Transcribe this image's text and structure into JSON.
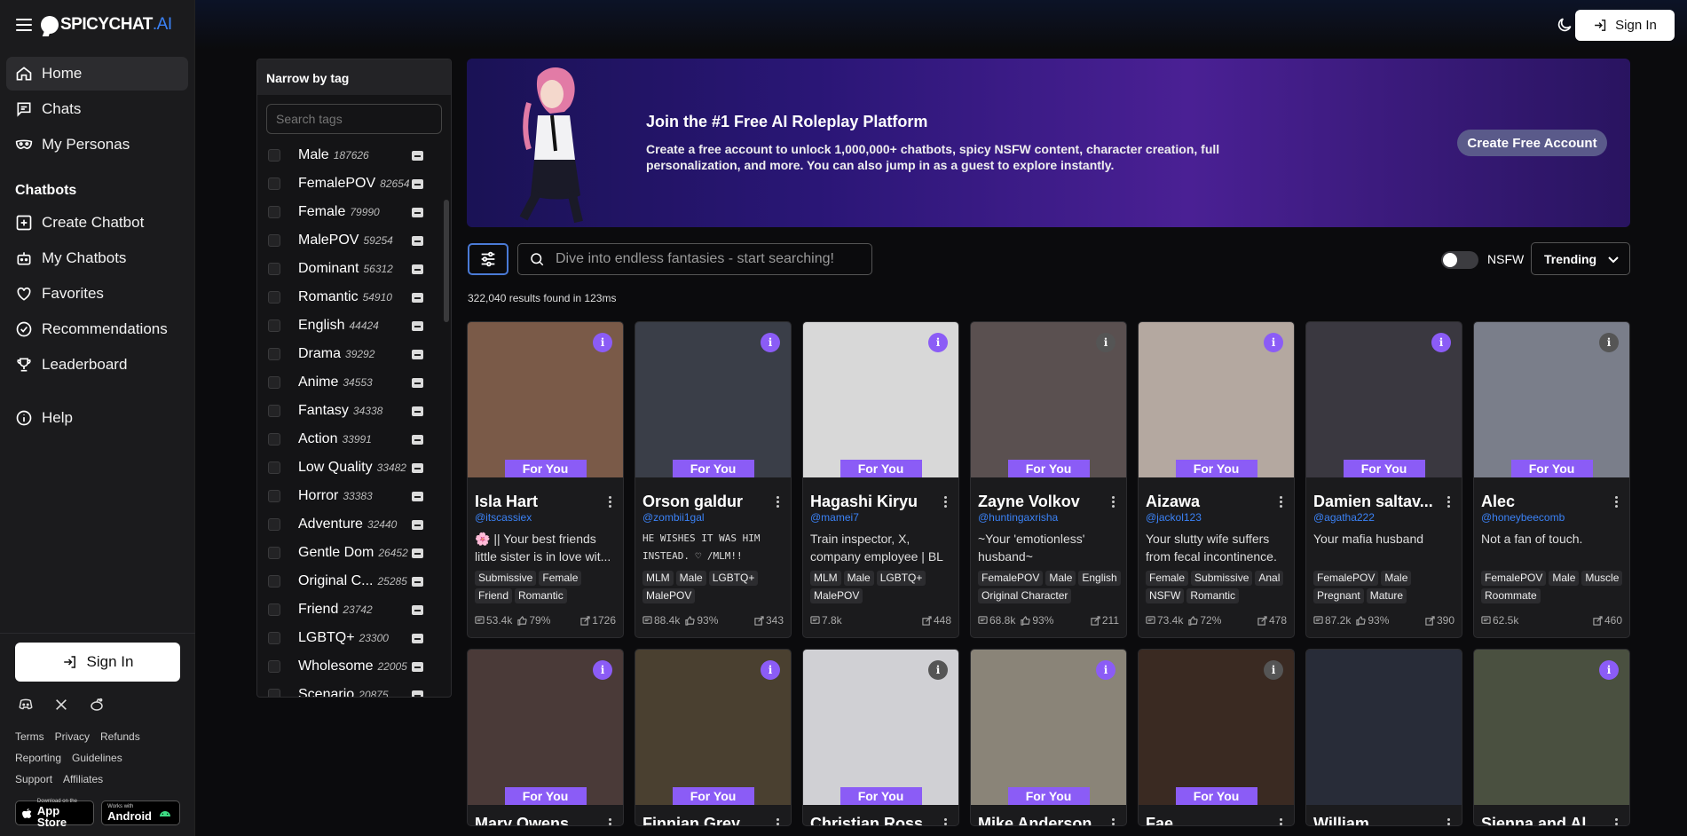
{
  "brand": {
    "name": "SPICYCHAT",
    "suffix": ".AI",
    "accent": "#3b82f6"
  },
  "nav": {
    "home": "Home",
    "chats": "Chats",
    "personas": "My Personas",
    "section": "Chatbots",
    "create": "Create Chatbot",
    "mychatbots": "My Chatbots",
    "favorites": "Favorites",
    "recommendations": "Recommendations",
    "leaderboard": "Leaderboard",
    "help": "Help"
  },
  "sidebar_bottom": {
    "sign_in": "Sign In",
    "links": [
      "Terms",
      "Privacy",
      "Refunds",
      "Reporting",
      "Guidelines",
      "Support",
      "Affiliates"
    ],
    "appstore_small": "Download on the",
    "appstore": "App Store",
    "android_small": "Works with",
    "android": "Android"
  },
  "topbar": {
    "sign_in": "Sign In"
  },
  "tags": {
    "header": "Narrow by tag",
    "placeholder": "Search tags",
    "items": [
      {
        "name": "Male",
        "count": "187626"
      },
      {
        "name": "FemalePOV",
        "count": "82654"
      },
      {
        "name": "Female",
        "count": "79990"
      },
      {
        "name": "MalePOV",
        "count": "59254"
      },
      {
        "name": "Dominant",
        "count": "56312"
      },
      {
        "name": "Romantic",
        "count": "54910"
      },
      {
        "name": "English",
        "count": "44424"
      },
      {
        "name": "Drama",
        "count": "39292"
      },
      {
        "name": "Anime",
        "count": "34553"
      },
      {
        "name": "Fantasy",
        "count": "34338"
      },
      {
        "name": "Action",
        "count": "33991"
      },
      {
        "name": "Low Quality",
        "count": "33482"
      },
      {
        "name": "Horror",
        "count": "33383"
      },
      {
        "name": "Adventure",
        "count": "32440"
      },
      {
        "name": "Gentle Dom",
        "count": "26452"
      },
      {
        "name": "Original C...",
        "count": "25285"
      },
      {
        "name": "Friend",
        "count": "23742"
      },
      {
        "name": "LGBTQ+",
        "count": "23300"
      },
      {
        "name": "Wholesome",
        "count": "22005"
      },
      {
        "name": "Scenario",
        "count": "20875"
      }
    ]
  },
  "banner": {
    "title": "Join the #1 Free AI Roleplay Platform",
    "text": "Create a free account to unlock 1,000,000+ chatbots, spicy NSFW content, character creation, full personalization, and more. You can also jump in as a guest to explore instantly.",
    "cta": "Create Free Account"
  },
  "search": {
    "placeholder": "Dive into endless fantasies - start searching!",
    "nsfw_label": "NSFW",
    "nsfw_on": false,
    "sort": "Trending"
  },
  "results": "322,040 results found in 123ms",
  "card_badge": "For You",
  "cards": [
    {
      "name": "Isla Hart",
      "user": "@itscassiex",
      "desc": "🌸 || Your best friends little sister is in love wit...",
      "tags": [
        "Submissive",
        "Female",
        "Friend",
        "Romantic"
      ],
      "chats": "53.4k",
      "likes": "79%",
      "shares": "1726",
      "bg": "#7a5a48",
      "info": "purple"
    },
    {
      "name": "Orson galdur",
      "user": "@zombii1gal",
      "desc": "HE WISHES IT WAS HIM INSTEAD. ♡ /MLM!!",
      "caps": true,
      "tags": [
        "MLM",
        "Male",
        "LGBTQ+",
        "MalePOV"
      ],
      "chats": "88.4k",
      "likes": "93%",
      "shares": "343",
      "bg": "#3a3e48",
      "info": "purple"
    },
    {
      "name": "Hagashi Kiryu",
      "user": "@mamei7",
      "desc": "Train inspector, X, company employee | BL",
      "tags": [
        "MLM",
        "Male",
        "LGBTQ+",
        "MalePOV"
      ],
      "chats": "7.8k",
      "likes": "",
      "shares": "448",
      "bg": "#d8d8d8",
      "info": "purple"
    },
    {
      "name": "Zayne Volkov",
      "user": "@huntingaxrisha",
      "desc": "~Your 'emotionless' husband~",
      "tags": [
        "FemalePOV",
        "Male",
        "English",
        "Original Character"
      ],
      "chats": "68.8k",
      "likes": "93%",
      "shares": "211",
      "bg": "#5a5050",
      "info": "dark"
    },
    {
      "name": "Aizawa",
      "user": "@jackol123",
      "desc": "Your slutty wife suffers from fecal incontinence.",
      "tags": [
        "Female",
        "Submissive",
        "Anal",
        "NSFW",
        "Romantic"
      ],
      "chats": "73.4k",
      "likes": "72%",
      "shares": "478",
      "bg": "#b4a8a0",
      "info": "purple"
    },
    {
      "name": "Damien saltav...",
      "user": "@agatha222",
      "desc": "Your mafia husband",
      "tags": [
        "FemalePOV",
        "Male",
        "Pregnant",
        "Mature"
      ],
      "chats": "87.2k",
      "likes": "93%",
      "shares": "390",
      "bg": "#3a3840",
      "info": "purple"
    },
    {
      "name": "Alec",
      "user": "@honeybeecomb",
      "desc": "Not a fan of touch.",
      "tags": [
        "FemalePOV",
        "Male",
        "Muscle",
        "Roommate"
      ],
      "chats": "62.5k",
      "likes": "",
      "shares": "460",
      "bg": "#7a7e8a",
      "info": "dark"
    }
  ],
  "cards2": [
    {
      "name": "Mary Owens",
      "bg": "#4a3a38",
      "info": "purple"
    },
    {
      "name": "Finnian Grey",
      "bg": "#4a4030",
      "info": "purple"
    },
    {
      "name": "Christian Ross",
      "bg": "#d0d0d4",
      "info": "dark"
    },
    {
      "name": "Mike Anderson",
      "bg": "#8a8478",
      "info": "purple"
    },
    {
      "name": "Fae",
      "bg": "#3a2a22",
      "info": "dark"
    },
    {
      "name": "William",
      "bg": "#282c38",
      "info": "none"
    },
    {
      "name": "Sienna and Al...",
      "bg": "#4a5040",
      "info": "purple"
    }
  ]
}
